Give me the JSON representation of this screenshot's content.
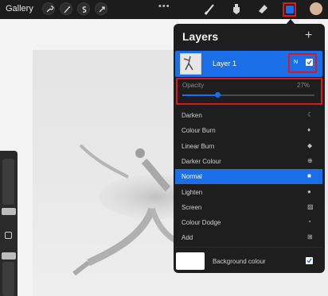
{
  "topbar": {
    "gallery_label": "Gallery",
    "tools": [
      "wrench-icon",
      "magic-wand-icon",
      "selection-icon",
      "transform-icon"
    ],
    "more": "•••",
    "brushes": [
      "brush-icon",
      "smudge-icon",
      "eraser-icon",
      "layers-icon"
    ]
  },
  "panel": {
    "title": "Layers",
    "add_label": "+",
    "layer": {
      "name": "Layer 1",
      "blend_letter": "N",
      "visible": true
    },
    "opacity": {
      "label": "Opacity",
      "value_text": "27%",
      "value": 0.27
    },
    "blend_modes": [
      {
        "label": "Darken",
        "icon": "moon-icon"
      },
      {
        "label": "Colour Burn",
        "icon": "flame-icon"
      },
      {
        "label": "Linear Burn",
        "icon": "flame-filled-icon"
      },
      {
        "label": "Darker Colour",
        "icon": "plus-circle-icon"
      },
      {
        "label": "Normal",
        "icon": "square-n-icon",
        "selected": true
      },
      {
        "label": "Lighten",
        "icon": "circle-icon"
      },
      {
        "label": "Screen",
        "icon": "hatched-square-icon"
      },
      {
        "label": "Colour Dodge",
        "icon": "dodge-icon"
      },
      {
        "label": "Add",
        "icon": "plus-square-icon"
      }
    ],
    "background": {
      "label": "Background colour",
      "visible": true
    }
  },
  "colors": {
    "accent": "#1a6fe8",
    "highlight": "#e0161d",
    "panel": "#1e1e1e"
  }
}
